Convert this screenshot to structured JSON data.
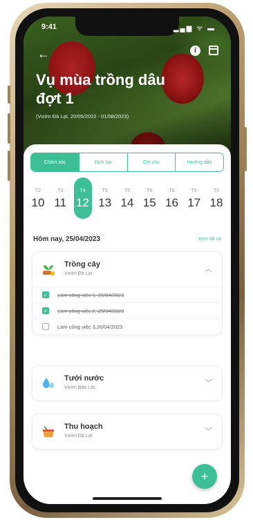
{
  "status": {
    "time": "9:41",
    "icons": "▂▄▆ ᯤ ▬"
  },
  "header": {
    "title": "Vụ mùa trồng dâu đợt 1",
    "subtitle": "(Vườn Đà Lạt, 20/05/2022 - 01/08/2023)"
  },
  "tabs": [
    {
      "label": "Chăm sóc",
      "active": true
    },
    {
      "label": "Dịch hại",
      "active": false
    },
    {
      "label": "Ghi chú",
      "active": false
    },
    {
      "label": "Hướng dẫn",
      "active": false
    }
  ],
  "days": [
    {
      "dow": "T2",
      "num": "10"
    },
    {
      "dow": "T3",
      "num": "11"
    },
    {
      "dow": "T4",
      "num": "12",
      "selected": true
    },
    {
      "dow": "T5",
      "num": "13"
    },
    {
      "dow": "T6",
      "num": "14"
    },
    {
      "dow": "T6",
      "num": "15"
    },
    {
      "dow": "T6",
      "num": "16"
    },
    {
      "dow": "T6",
      "num": "17"
    },
    {
      "dow": "T6",
      "num": "18"
    }
  ],
  "today": {
    "label": "Hôm nay, 25/04/2023",
    "see_all": "Xem tất cả"
  },
  "groups": [
    {
      "title": "Trồng cây",
      "sub": "Vườn Đà Lạt",
      "icon": "plant-icon",
      "expanded": true,
      "tasks": [
        {
          "text": "Làm công việc 1, 25/04/2023",
          "done": true
        },
        {
          "text": "Làm công việc 2, 25/04/2023",
          "done": true
        },
        {
          "text": "Làm công việc 3,26/04/2023",
          "done": false
        }
      ]
    },
    {
      "title": "Tưới nước",
      "sub": "Vườn Bảo Lộc",
      "icon": "water-drop-icon",
      "expanded": false
    },
    {
      "title": "Thu hoạch",
      "sub": "Vườn Đà Lạt",
      "icon": "harvest-basket-icon",
      "expanded": false
    }
  ],
  "fab": {
    "label": "+"
  },
  "colors": {
    "accent": "#3dbf95"
  }
}
